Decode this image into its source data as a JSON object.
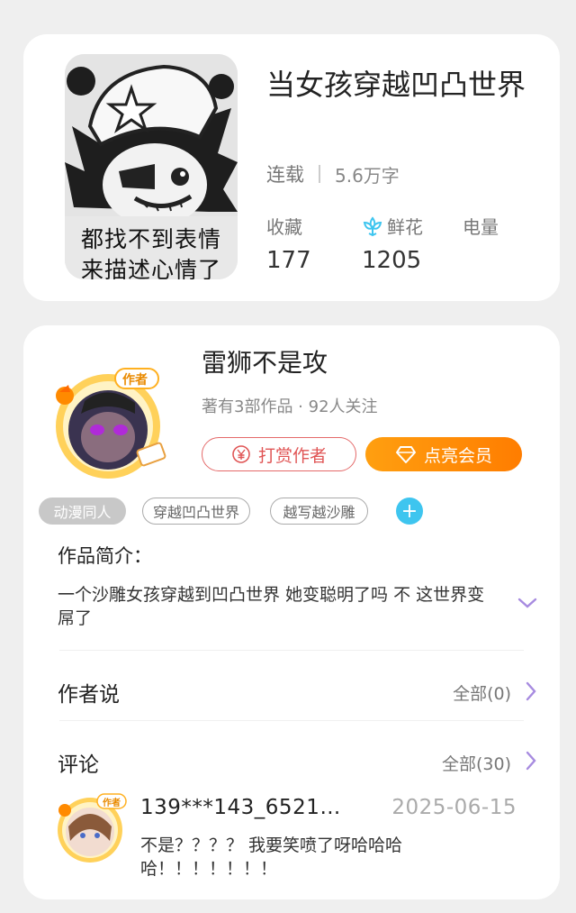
{
  "book": {
    "cover_caption_line1": "都找不到表情",
    "cover_caption_line2": "来描述心情了",
    "title": "当女孩穿越凹凸世界",
    "status": "连载",
    "word_count": "5.6万字",
    "stats": [
      {
        "label": "收藏",
        "value": "177"
      },
      {
        "label": "鲜花",
        "value": "1205",
        "icon": "flower-icon"
      },
      {
        "label": "电量",
        "value": ""
      }
    ]
  },
  "author": {
    "badge": "作者",
    "name": "雷狮不是攻",
    "meta": "著有3部作品 · 92人关注",
    "tip_button": "打赏作者",
    "vip_button": "点亮会员",
    "tags": [
      "动漫同人",
      "穿越凹凸世界",
      "越写越沙雕"
    ],
    "add_tag_icon": "plus-icon"
  },
  "intro": {
    "label": "作品简介：",
    "text": "一个沙雕女孩穿越到凹凸世界 她变聪明了吗 不 这世界变屌了"
  },
  "author_says": {
    "title": "作者说",
    "more": "全部(0)"
  },
  "comments": {
    "title": "评论",
    "more": "全部(30)",
    "items": [
      {
        "badge": "作者",
        "user": "139***143_6521…",
        "date": "2025-06-15",
        "text": "不是？？？？ 我要笑喷了呀哈哈哈哈！！！！！！！"
      }
    ]
  },
  "colors": {
    "accent_purple": "#a78be0",
    "vip_orange": "#ff8a00",
    "tip_red": "#e05555",
    "tag_blue": "#3ec5ef"
  }
}
